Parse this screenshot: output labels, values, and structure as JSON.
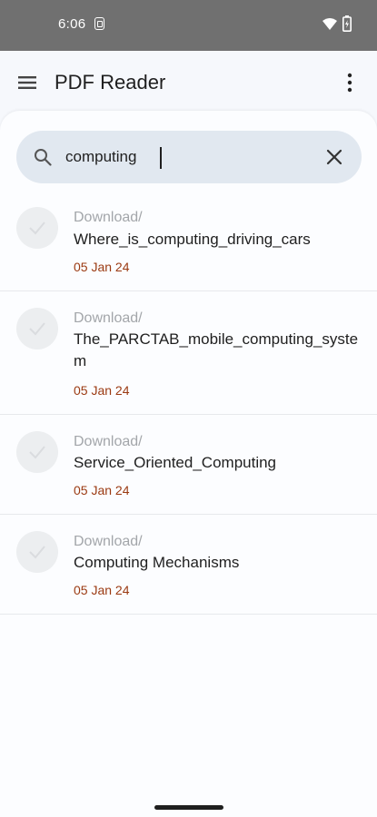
{
  "status_bar": {
    "time": "6:06"
  },
  "app_bar": {
    "title": "PDF Reader"
  },
  "search": {
    "value": "computing"
  },
  "files": [
    {
      "folder": "Download/",
      "name": "Where_is_computing_driving_cars",
      "date": "05 Jan 24"
    },
    {
      "folder": "Download/",
      "name": "The_PARCTAB_mobile_computing_system",
      "date": "05 Jan 24"
    },
    {
      "folder": "Download/",
      "name": "Service_Oriented_Computing",
      "date": "05 Jan 24"
    },
    {
      "folder": "Download/",
      "name": "Computing Mechanisms",
      "date": "05 Jan 24"
    }
  ],
  "colors": {
    "date": "#9b3a12",
    "search_bg": "#e1e8f0",
    "status_bar": "#707070"
  }
}
